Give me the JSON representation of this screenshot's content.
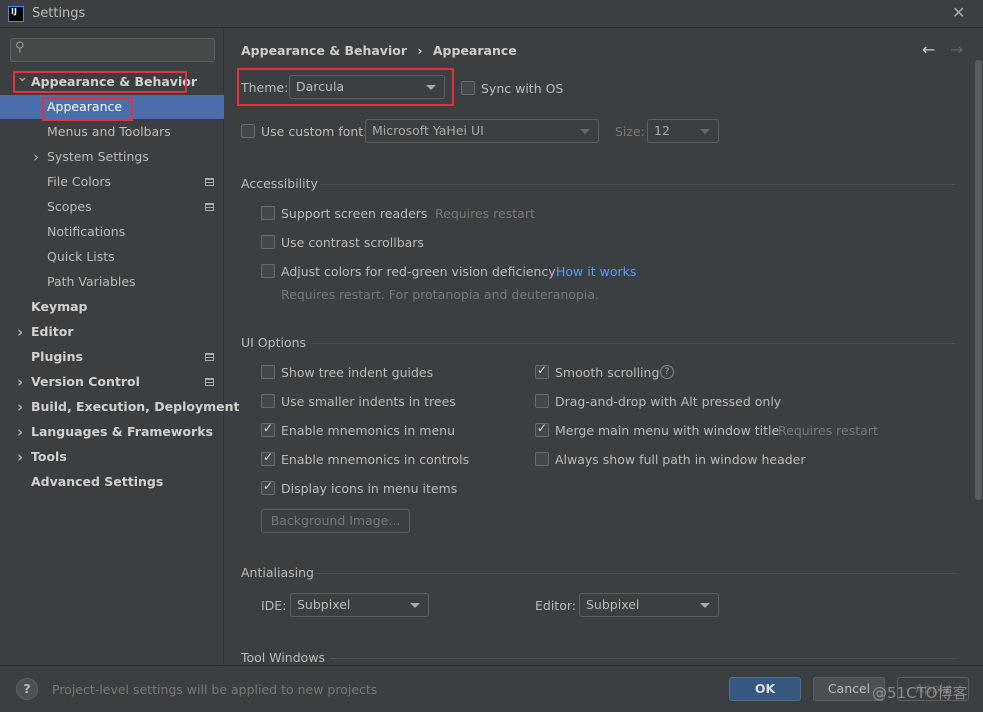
{
  "window": {
    "title": "Settings",
    "close_icon": "close-icon",
    "app_icon": "intellij-logo",
    "logo_text": "IJ"
  },
  "search": {
    "placeholder": "",
    "icon": "search-icon"
  },
  "sidebar": {
    "items": [
      {
        "label": "Appearance & Behavior",
        "level": 0,
        "expanded": true,
        "bold": true
      },
      {
        "label": "Appearance",
        "level": 1,
        "selected": true
      },
      {
        "label": "Menus and Toolbars",
        "level": 1
      },
      {
        "label": "System Settings",
        "level": 1,
        "collapsed": true
      },
      {
        "label": "File Colors",
        "level": 1,
        "project_icon": true
      },
      {
        "label": "Scopes",
        "level": 1,
        "project_icon": true
      },
      {
        "label": "Notifications",
        "level": 1
      },
      {
        "label": "Quick Lists",
        "level": 1
      },
      {
        "label": "Path Variables",
        "level": 1
      },
      {
        "label": "Keymap",
        "level": 0,
        "bold": true
      },
      {
        "label": "Editor",
        "level": 0,
        "collapsed": true,
        "bold": true
      },
      {
        "label": "Plugins",
        "level": 0,
        "bold": true,
        "project_icon": true
      },
      {
        "label": "Version Control",
        "level": 0,
        "collapsed": true,
        "bold": true,
        "project_icon": true
      },
      {
        "label": "Build, Execution, Deployment",
        "level": 0,
        "collapsed": true,
        "bold": true
      },
      {
        "label": "Languages & Frameworks",
        "level": 0,
        "collapsed": true,
        "bold": true
      },
      {
        "label": "Tools",
        "level": 0,
        "collapsed": true,
        "bold": true
      },
      {
        "label": "Advanced Settings",
        "level": 0,
        "bold": true
      }
    ]
  },
  "breadcrumb": {
    "parent": "Appearance & Behavior",
    "separator": "›",
    "current": "Appearance"
  },
  "theme": {
    "label": "Theme:",
    "value": "Darcula",
    "sync_label": "Sync with OS",
    "sync_checked": false
  },
  "font": {
    "label": "Use custom font:",
    "checked": false,
    "value": "Microsoft YaHei UI",
    "size_label": "Size:",
    "size_value": "12"
  },
  "accessibility": {
    "title": "Accessibility",
    "screen_readers": {
      "label": "Support screen readers",
      "note": "Requires restart",
      "checked": false
    },
    "contrast": {
      "label": "Use contrast scrollbars",
      "checked": false
    },
    "redgreen": {
      "label": "Adjust colors for red-green vision deficiency",
      "link": "How it works",
      "note": "Requires restart. For protanopia and deuteranopia.",
      "checked": false
    }
  },
  "ui_options": {
    "title": "UI Options",
    "left": [
      {
        "label": "Show tree indent guides",
        "checked": false
      },
      {
        "label": "Use smaller indents in trees",
        "checked": false
      },
      {
        "label": "Enable mnemonics in menu",
        "checked": true
      },
      {
        "label": "Enable mnemonics in controls",
        "checked": true
      },
      {
        "label": "Display icons in menu items",
        "checked": true
      }
    ],
    "right": [
      {
        "label": "Smooth scrolling",
        "checked": true,
        "help": "?"
      },
      {
        "label": "Drag-and-drop with Alt pressed only",
        "checked": false
      },
      {
        "label": "Merge main menu with window title",
        "checked": true,
        "note": "Requires restart"
      },
      {
        "label": "Always show full path in window header",
        "checked": false
      }
    ],
    "background_button": "Background Image..."
  },
  "antialiasing": {
    "title": "Antialiasing",
    "ide_label": "IDE:",
    "ide_value": "Subpixel",
    "editor_label": "Editor:",
    "editor_value": "Subpixel"
  },
  "tool_windows": {
    "title": "Tool Windows"
  },
  "footer": {
    "help": "?",
    "note": "Project-level settings will be applied to new projects",
    "ok": "OK",
    "cancel": "Cancel",
    "apply": "Apply"
  },
  "watermark": "@51CTO博客",
  "colors": {
    "accent": "#4b6eaf",
    "ok_button": "#365880",
    "highlight_box": "#e8303a",
    "link": "#589df6"
  }
}
